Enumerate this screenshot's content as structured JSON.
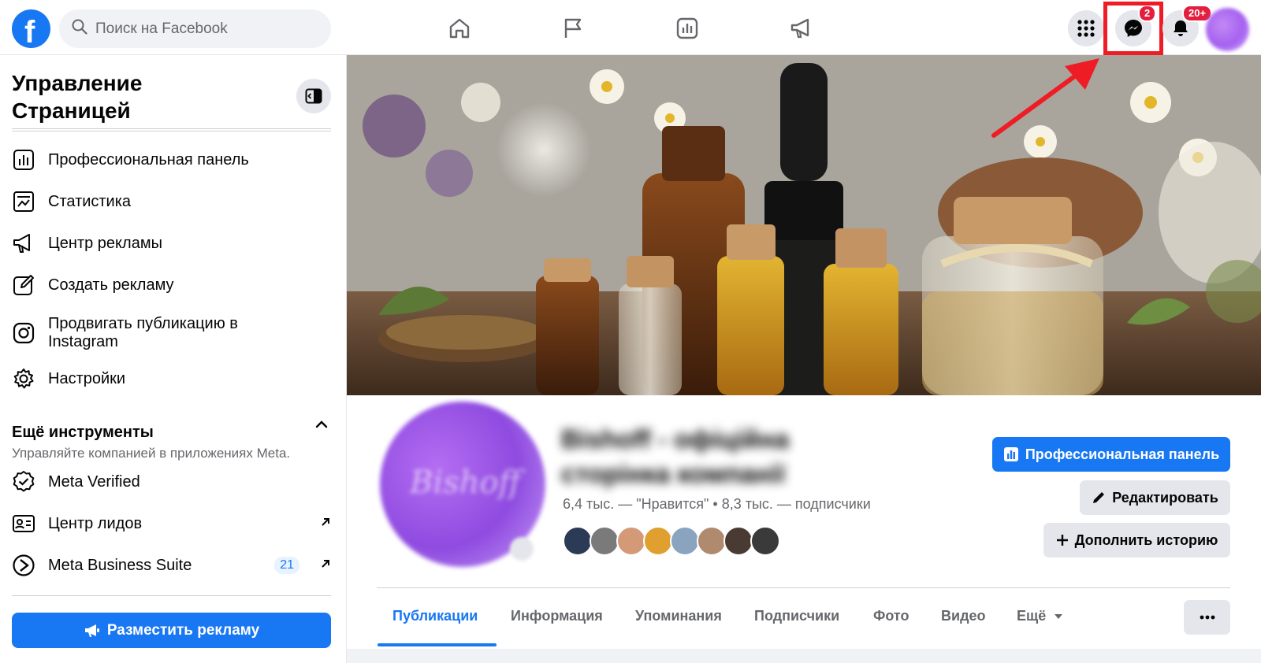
{
  "header": {
    "search_placeholder": "Поиск на Facebook",
    "nav_icons": [
      "home-icon",
      "flag-icon",
      "analytics-icon",
      "megaphone-icon"
    ],
    "menu_icon": "grid-menu-icon",
    "messenger_badge": "2",
    "notifications_badge": "20+"
  },
  "sidebar": {
    "title": "Управление Страницей",
    "items": [
      {
        "label": "Профессиональная панель",
        "icon": "dashboard-icon"
      },
      {
        "label": "Статистика",
        "icon": "insights-icon"
      },
      {
        "label": "Центр рекламы",
        "icon": "megaphone-icon"
      },
      {
        "label": "Создать рекламу",
        "icon": "edit-icon"
      },
      {
        "label": "Продвигать публикацию в Instagram",
        "icon": "instagram-icon"
      },
      {
        "label": "Настройки",
        "icon": "gear-icon"
      }
    ],
    "tools_title": "Ещё инструменты",
    "tools_subtitle": "Управляйте компанией в приложениях Meta.",
    "tools": [
      {
        "label": "Meta Verified",
        "icon": "verified-icon"
      },
      {
        "label": "Центр лидов",
        "icon": "contact-card-icon"
      },
      {
        "label": "Meta Business Suite",
        "icon": "business-suite-icon",
        "count": "21"
      }
    ],
    "cta_label": "Разместить рекламу"
  },
  "profile": {
    "name": "Bishoff - офіційна сторінка компанії",
    "stats": "6,4 тыс. — \"Нравится\" • 8,3 тыс. — подписчики",
    "primary_button": "Профессиональная панель",
    "edit_button": "Редактировать",
    "story_button": "Дополнить историю"
  },
  "tabs": [
    "Публикации",
    "Информация",
    "Упоминания",
    "Подписчики",
    "Фото",
    "Видео",
    "Ещё"
  ],
  "colors": {
    "brand": "#1877f2",
    "badge": "#e41e3f",
    "annotation": "#ee1c25"
  }
}
